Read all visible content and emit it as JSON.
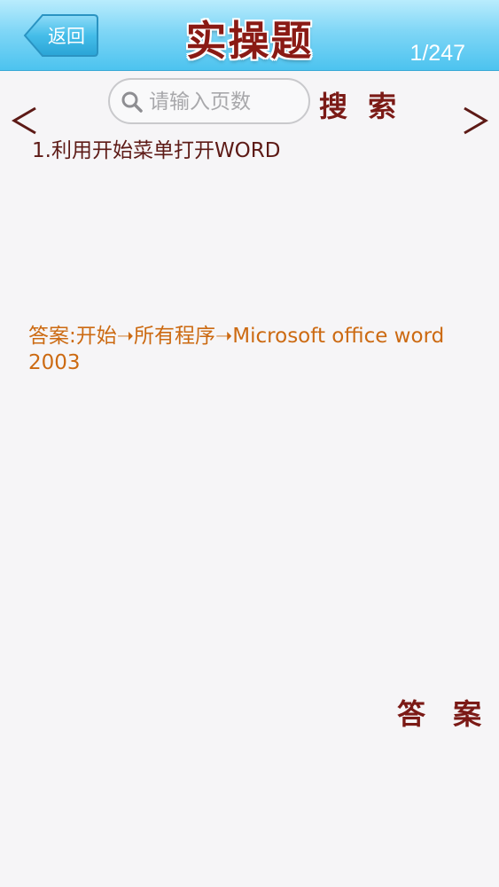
{
  "header": {
    "back_label": "返回",
    "title": "实操题",
    "page_indicator": "1/247"
  },
  "search": {
    "placeholder": "请输入页数",
    "value": "",
    "button_label": "搜 索"
  },
  "nav": {
    "prev_icon": "chevron-left-icon",
    "next_icon": "chevron-right-icon"
  },
  "content": {
    "question": "1.利用开始菜单打开WORD",
    "answer": "答案:开始➝所有程序➝Microsoft office word2003",
    "answer_button_label": "答 案"
  },
  "colors": {
    "header_top": "#b9ecfd",
    "header_bottom": "#4cc3ef",
    "title": "#8a1a14",
    "question_text": "#5d1a16",
    "answer_text": "#cc6a12",
    "button_text": "#7b1a16",
    "background": "#f6f5f7"
  }
}
